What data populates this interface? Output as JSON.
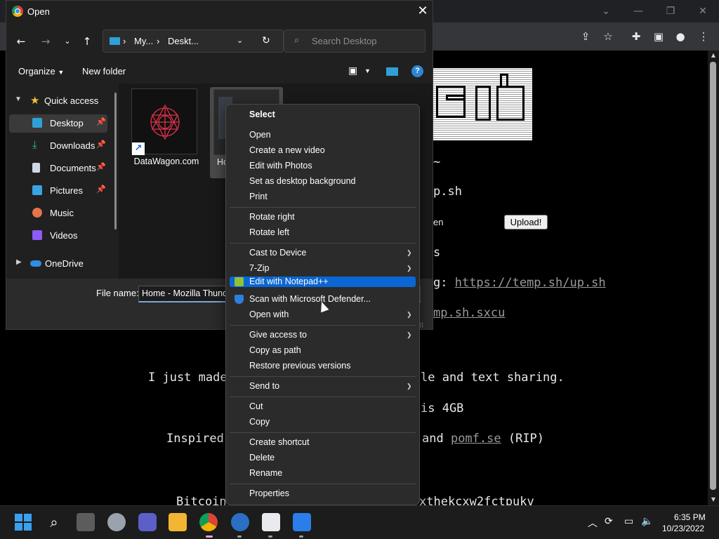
{
  "dialog": {
    "title": "Open",
    "address": {
      "seg1": "My...",
      "sep1": "›",
      "seg2": "Deskt...",
      "sep0": "›"
    },
    "search_placeholder": "Search Desktop",
    "organize_label": "Organize",
    "new_folder_label": "New folder",
    "nav": {
      "quick_access": "Quick access",
      "items": [
        {
          "label": "Desktop",
          "selected": true,
          "pinned": true
        },
        {
          "label": "Downloads",
          "pinned": true
        },
        {
          "label": "Documents",
          "pinned": true
        },
        {
          "label": "Pictures",
          "pinned": true
        },
        {
          "label": "Music"
        },
        {
          "label": "Videos"
        }
      ],
      "onedrive": "OneDrive"
    },
    "files": [
      {
        "name": "DataWagon.com"
      },
      {
        "name": "Hor... Thun..."
      }
    ],
    "file_name_label": "File name:",
    "file_name_value": "Home - Mozilla Thund"
  },
  "context_menu": {
    "header": "Select",
    "groups": [
      [
        "Open",
        "Create a new video",
        "Edit with Photos",
        "Set as desktop background",
        "Print"
      ],
      [
        "Rotate right",
        "Rotate left"
      ],
      [
        "Cast to Device",
        "7-Zip",
        "Edit with Notepad++",
        "Scan with Microsoft Defender...",
        "Open with"
      ],
      [
        "Give access to",
        "Copy as path",
        "Restore previous versions"
      ],
      [
        "Send to"
      ],
      [
        "Cut",
        "Copy"
      ],
      [
        "Create shortcut",
        "Delete",
        "Rename"
      ],
      [
        "Properties"
      ]
    ],
    "highlighted": "Edit with Notepad++"
  },
  "webpage": {
    "tilde": "~",
    "line_upsh": "p.sh",
    "browse_partial": "en",
    "upload_button": "Upload!",
    "line_s": "s",
    "line_g_prefix": "g: ",
    "upsh_link": "https://temp.sh/up.sh",
    "sxcu_link": "mp.sh.sxcu",
    "made_prefix": "I just made",
    "made_suffix": "le and text sharing.",
    "limit_text": "is 4GB",
    "inspired_prefix": "Inspired",
    "and_text": "and ",
    "pomf_link": "pomf.se",
    "rip_text": " (RIP)",
    "bitcoin_prefix": "Bitcoin",
    "bitcoin_suffix": "xthekcxw2fctpukv"
  },
  "taskbar": {
    "time": "6:35 PM",
    "date": "10/23/2022"
  }
}
